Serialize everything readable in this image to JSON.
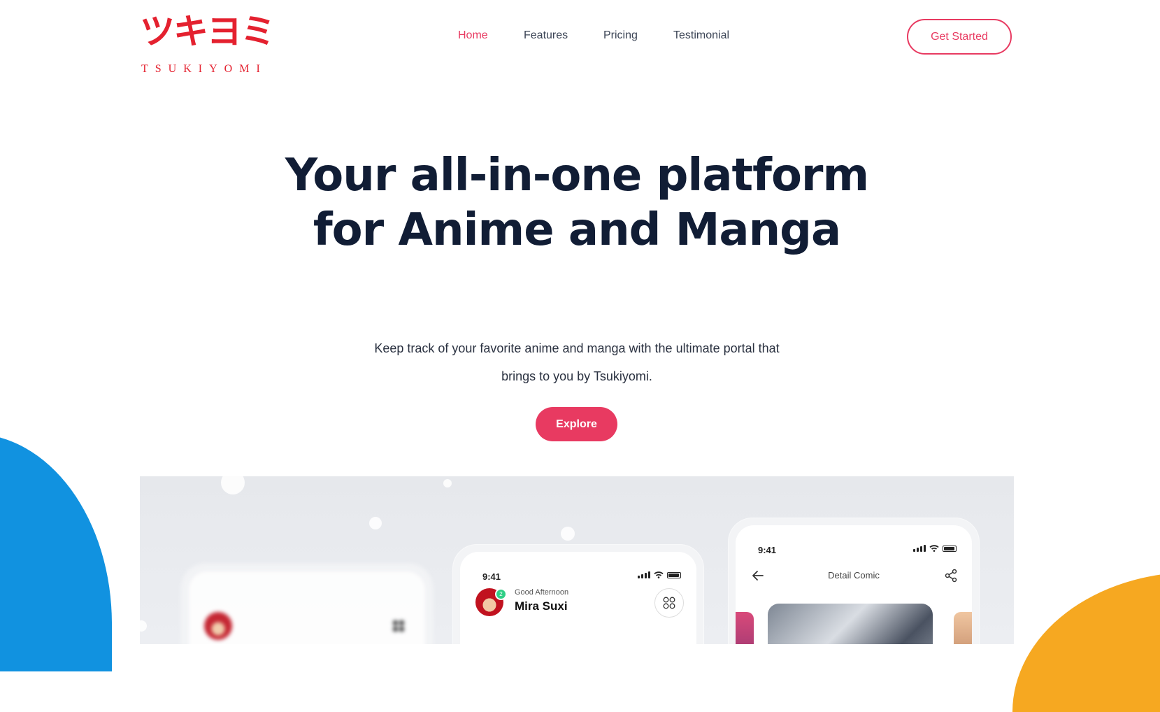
{
  "brand": {
    "logo_kana": "ツキヨミ",
    "logo_roman": "TSUKIYOMI",
    "accent_color": "#e83a61",
    "logo_color": "#e4212f"
  },
  "nav": {
    "items": [
      {
        "label": "Home",
        "active": true
      },
      {
        "label": "Features",
        "active": false
      },
      {
        "label": "Pricing",
        "active": false
      },
      {
        "label": "Testimonial",
        "active": false
      }
    ],
    "cta_label": "Get Started"
  },
  "hero": {
    "title": "Your all-in-one platform for Anime and Manga",
    "subtitle": "Keep track of your favorite anime and manga with the ultimate portal that brings to you by Tsukiyomi.",
    "button_label": "Explore"
  },
  "showcase": {
    "phone_home": {
      "time": "9:41",
      "greeting": "Good Afternoon",
      "user_name": "Mira Suxi",
      "notification_count": "2"
    },
    "phone_detail": {
      "time": "9:41",
      "title": "Detail Comic"
    },
    "decor_colors": {
      "blue": "#1192e0",
      "orange": "#f6a821"
    }
  }
}
